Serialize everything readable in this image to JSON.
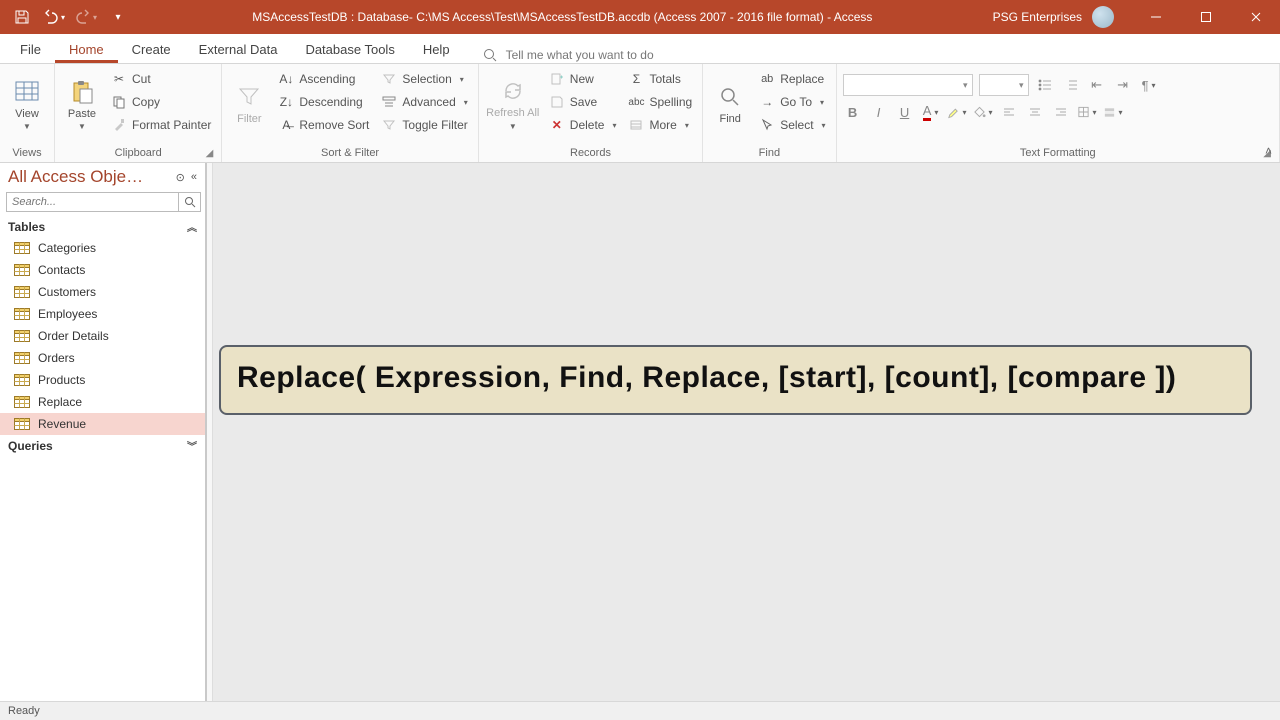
{
  "title": "MSAccessTestDB : Database- C:\\MS Access\\Test\\MSAccessTestDB.accdb (Access 2007 - 2016 file format)  -  Access",
  "user": "PSG Enterprises",
  "tabs": {
    "items": [
      "File",
      "Home",
      "Create",
      "External Data",
      "Database Tools",
      "Help"
    ],
    "activeIndex": 1,
    "tellMe": "Tell me what you want to do"
  },
  "ribbon": {
    "views": {
      "label": "Views",
      "view": "View"
    },
    "clipboard": {
      "label": "Clipboard",
      "paste": "Paste",
      "cut": "Cut",
      "copy": "Copy",
      "fp": "Format Painter"
    },
    "sortfilter": {
      "label": "Sort & Filter",
      "filter": "Filter",
      "asc": "Ascending",
      "desc": "Descending",
      "rs": "Remove Sort",
      "sel": "Selection",
      "adv": "Advanced",
      "tf": "Toggle Filter"
    },
    "records": {
      "label": "Records",
      "refresh": "Refresh All",
      "new": "New",
      "save": "Save",
      "delete": "Delete",
      "totals": "Totals",
      "spelling": "Spelling",
      "more": "More"
    },
    "find": {
      "label": "Find",
      "find": "Find",
      "replace": "Replace",
      "goto": "Go To",
      "select": "Select"
    },
    "textfmt": {
      "label": "Text Formatting"
    }
  },
  "nav": {
    "title": "All Access Obje…",
    "searchPlaceholder": "Search...",
    "cats": {
      "tables": "Tables",
      "queries": "Queries"
    },
    "tables": [
      "Categories",
      "Contacts",
      "Customers",
      "Employees",
      "Order Details",
      "Orders",
      "Products",
      "Replace",
      "Revenue"
    ],
    "selected": "Revenue"
  },
  "callout": "Replace( Expression, Find, Replace,   [start], [count], [compare ])",
  "status": "Ready"
}
